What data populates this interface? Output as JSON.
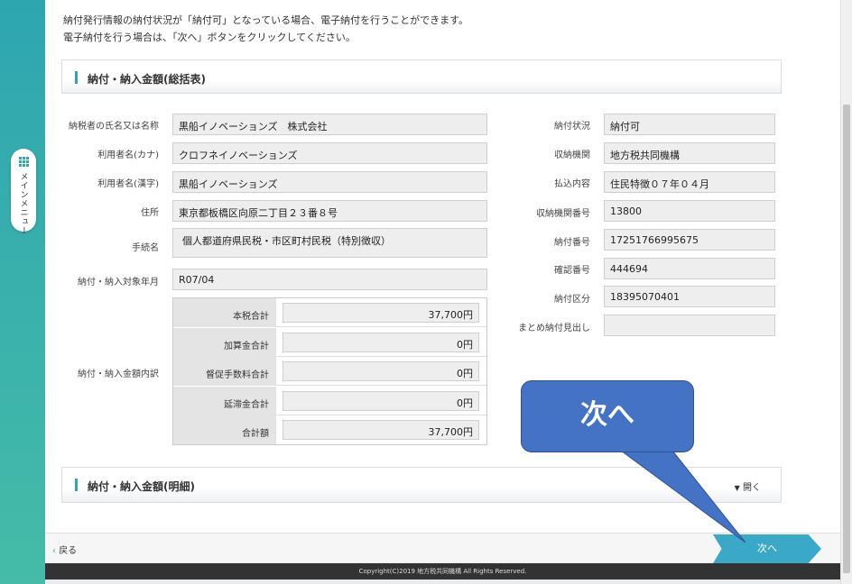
{
  "sidebar": {
    "menu_label": "メインメニュー"
  },
  "intro": {
    "line1": "納付発行情報の納付状況が「納付可」となっている場合、電子納付を行うことができます。",
    "line2": "電子納付を行う場合は、「次へ」ボタンをクリックしてください。"
  },
  "summary_panel": {
    "title": "納付・納入金額(総括表)"
  },
  "left_fields": [
    {
      "label": "納税者の氏名又は名称",
      "value": "黒船イノベーションズ　株式会社"
    },
    {
      "label": "利用者名(カナ)",
      "value": "クロフネイノベーションズ"
    },
    {
      "label": "利用者名(漢字)",
      "value": "黒船イノベーションズ"
    },
    {
      "label": "住所",
      "value": "東京都板橋区向原二丁目２３番８号"
    },
    {
      "label": "手続名",
      "value": "個人都道府県民税・市区町村民税（特別徴収）"
    },
    {
      "label": "納付・納入対象年月",
      "value": "R07/04"
    }
  ],
  "breakdown": {
    "label": "納付・納入金額内訳",
    "rows": [
      {
        "label": "本税合計",
        "value": "37,700円"
      },
      {
        "label": "加算金合計",
        "value": "0円"
      },
      {
        "label": "督促手数料合計",
        "value": "0円"
      },
      {
        "label": "延滞金合計",
        "value": "0円"
      },
      {
        "label": "合計額",
        "value": "37,700円"
      }
    ]
  },
  "right_fields": [
    {
      "label": "納付状況",
      "value": "納付可"
    },
    {
      "label": "収納機関",
      "value": "地方税共同機構"
    },
    {
      "label": "払込内容",
      "value": "住民特徴０７年０４月"
    },
    {
      "label": "収納機関番号",
      "value": "13800"
    },
    {
      "label": "納付番号",
      "value": "17251766995675"
    },
    {
      "label": "確認番号",
      "value": "444694"
    },
    {
      "label": "納付区分",
      "value": "18395070401"
    },
    {
      "label": "まとめ納付見出し",
      "value": ""
    }
  ],
  "detail_panel": {
    "title": "納付・納入金額(明細)",
    "toggle": "開く"
  },
  "footer": {
    "back": "戻る",
    "next": "次へ",
    "copyright": "Copyright(C)2019 地方税共同機構 All Rights Reserved."
  },
  "callout": {
    "text": "次へ",
    "color": "#4472c4"
  }
}
